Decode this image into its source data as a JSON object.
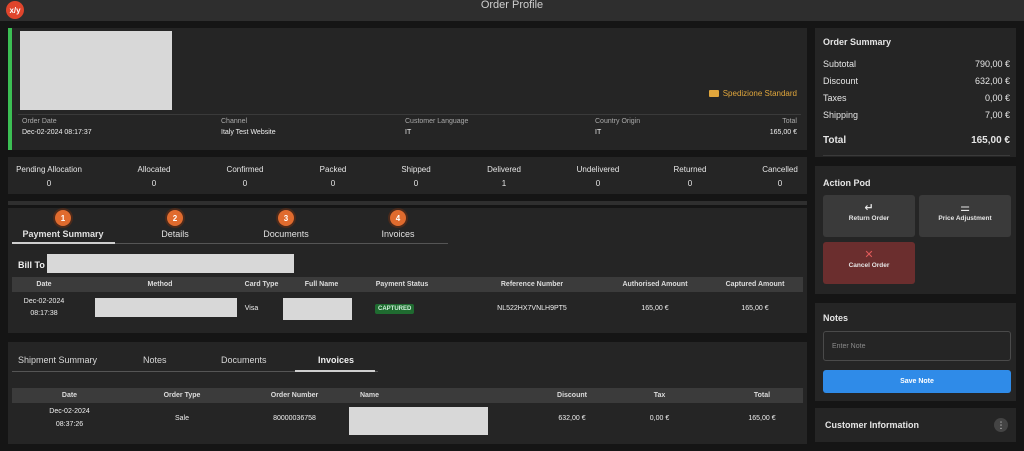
{
  "window": {
    "title": "Order Profile",
    "badge": "x/y"
  },
  "header": {
    "shipping_method": "Spedizione Standard",
    "meta": [
      {
        "label": "Order Date",
        "value": "Dec-02-2024 08:17:37"
      },
      {
        "label": "Channel",
        "value": "Italy Test Website"
      },
      {
        "label": "Customer Language",
        "value": "IT"
      },
      {
        "label": "Country Origin",
        "value": "IT"
      },
      {
        "label": "Total",
        "value": "165,00 €"
      }
    ]
  },
  "status_counts": [
    {
      "label": "Pending Allocation",
      "value": "0"
    },
    {
      "label": "Allocated",
      "value": "0"
    },
    {
      "label": "Confirmed",
      "value": "0"
    },
    {
      "label": "Packed",
      "value": "0"
    },
    {
      "label": "Shipped",
      "value": "0"
    },
    {
      "label": "Delivered",
      "value": "1"
    },
    {
      "label": "Undelivered",
      "value": "0"
    },
    {
      "label": "Returned",
      "value": "0"
    },
    {
      "label": "Cancelled",
      "value": "0"
    }
  ],
  "payment_tabs": [
    {
      "num": "1",
      "label": "Payment Summary"
    },
    {
      "num": "2",
      "label": "Details"
    },
    {
      "num": "3",
      "label": "Documents"
    },
    {
      "num": "4",
      "label": "Invoices"
    }
  ],
  "bill_to": "Bill To",
  "payment_table": {
    "columns": [
      "Date",
      "Method",
      "Card Type",
      "Full Name",
      "Payment Status",
      "Reference Number",
      "Authorised Amount",
      "Captured Amount"
    ],
    "row": {
      "date": "Dec-02-2024",
      "time": "08:17:38",
      "card_type": "Visa",
      "status": "CAPTURED",
      "reference": "NL522HX7VNLH9PT5",
      "authorised": "165,00 €",
      "captured": "165,00 €"
    }
  },
  "shipment_tabs": [
    "Shipment Summary",
    "Notes",
    "Documents",
    "Invoices"
  ],
  "invoice_table": {
    "columns": [
      "Date",
      "Order Type",
      "Order Number",
      "Name",
      "Discount",
      "Tax",
      "Total"
    ],
    "row": {
      "date": "Dec-02-2024",
      "time": "08:37:26",
      "order_type": "Sale",
      "order_number": "80000036758",
      "discount": "632,00 €",
      "tax": "0,00 €",
      "total": "165,00 €"
    }
  },
  "order_summary": {
    "title": "Order Summary",
    "rows": [
      {
        "label": "Subtotal",
        "value": "790,00 €"
      },
      {
        "label": "Discount",
        "value": "632,00 €"
      },
      {
        "label": "Taxes",
        "value": "0,00 €"
      },
      {
        "label": "Shipping",
        "value": "7,00 €"
      }
    ],
    "total_label": "Total",
    "total_value": "165,00 €"
  },
  "action_pod": {
    "title": "Action Pod",
    "return_order": "Return Order",
    "price_adjustment": "Price Adjustment",
    "cancel_order": "Cancel Order"
  },
  "notes": {
    "title": "Notes",
    "placeholder": "Enter Note",
    "save": "Save Note"
  },
  "customer_info": {
    "title": "Customer Information"
  }
}
